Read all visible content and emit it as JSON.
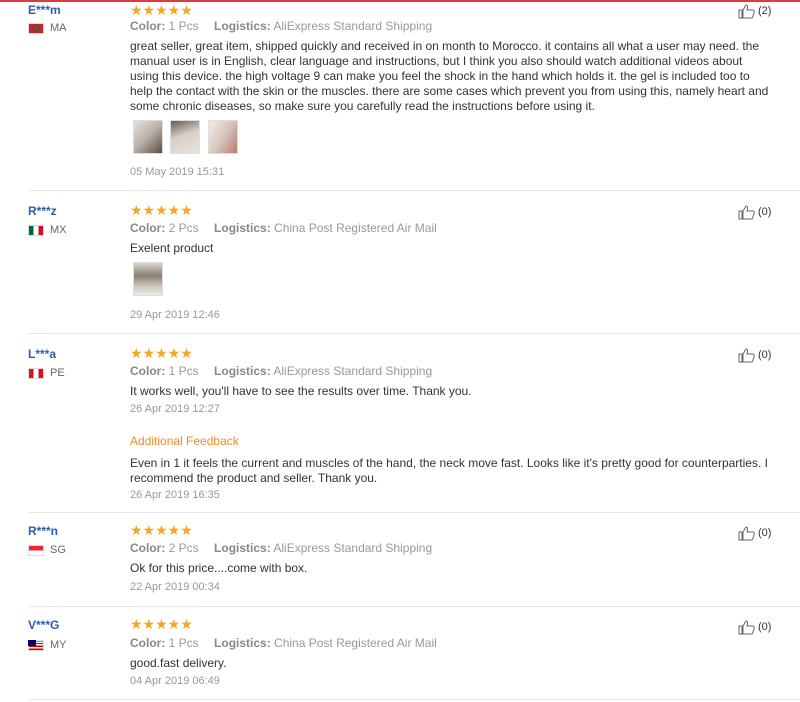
{
  "reviews": [
    {
      "name": "E***m",
      "country": "MA",
      "stars": "★★★★★",
      "color_label": "Color:",
      "color_value": "1 Pcs",
      "logistics_label": "Logistics:",
      "logistics_value": "AliExpress Standard Shipping",
      "text": "great seller, great item, shipped quickly and received in on month to Morocco. it contains all what a user may need. the manual user is in English, clear language and instructions, but I think you also should watch additional videos about using this device. the high voltage 9 can make you feel the shock in the hand which holds it. the gel is included too to help the contact with the skin or the muscles. there are some cases which prevent you from using this, namely heart and some chronic diseases, so make sure you carefully read the instructions before using it.",
      "date": "05 May 2019 15:31",
      "helpful": "(2)"
    },
    {
      "name": "R***z",
      "country": "MX",
      "stars": "★★★★★",
      "color_label": "Color:",
      "color_value": "2 Pcs",
      "logistics_label": "Logistics:",
      "logistics_value": "China Post Registered Air Mail",
      "text": "Exelent product",
      "date": "29 Apr 2019 12:46",
      "helpful": "(0)"
    },
    {
      "name": "L***a",
      "country": "PE",
      "stars": "★★★★★",
      "color_label": "Color:",
      "color_value": "1 Pcs",
      "logistics_label": "Logistics:",
      "logistics_value": "AliExpress Standard Shipping",
      "text": "It works well, you'll have to see the results over time. Thank you.",
      "date": "26 Apr 2019 12:27",
      "additional_label": "Additional Feedback",
      "additional_text": "Even in 1 it feels the current and muscles of the hand, the neck move fast. Looks like it's pretty good for counterparties. I recommend the product and seller. Thank you.",
      "additional_date": "26 Apr 2019 16:35",
      "helpful": "(0)"
    },
    {
      "name": "R***n",
      "country": "SG",
      "stars": "★★★★★",
      "color_label": "Color:",
      "color_value": "2 Pcs",
      "logistics_label": "Logistics:",
      "logistics_value": "AliExpress Standard Shipping",
      "text": "Ok for this price....come with box.",
      "date": "22 Apr 2019 00:34",
      "helpful": "(0)"
    },
    {
      "name": "V***G",
      "country": "MY",
      "stars": "★★★★★",
      "color_label": "Color:",
      "color_value": "1 Pcs",
      "logistics_label": "Logistics:",
      "logistics_value": "China Post Registered Air Mail",
      "text": "good.fast delivery.",
      "date": "04 Apr 2019 06:49",
      "helpful": "(0)"
    }
  ],
  "colors": {
    "accent_red": "#e4393c",
    "star": "#f5a623",
    "username": "#2a5db0",
    "additional_feedback": "#f08a24"
  }
}
